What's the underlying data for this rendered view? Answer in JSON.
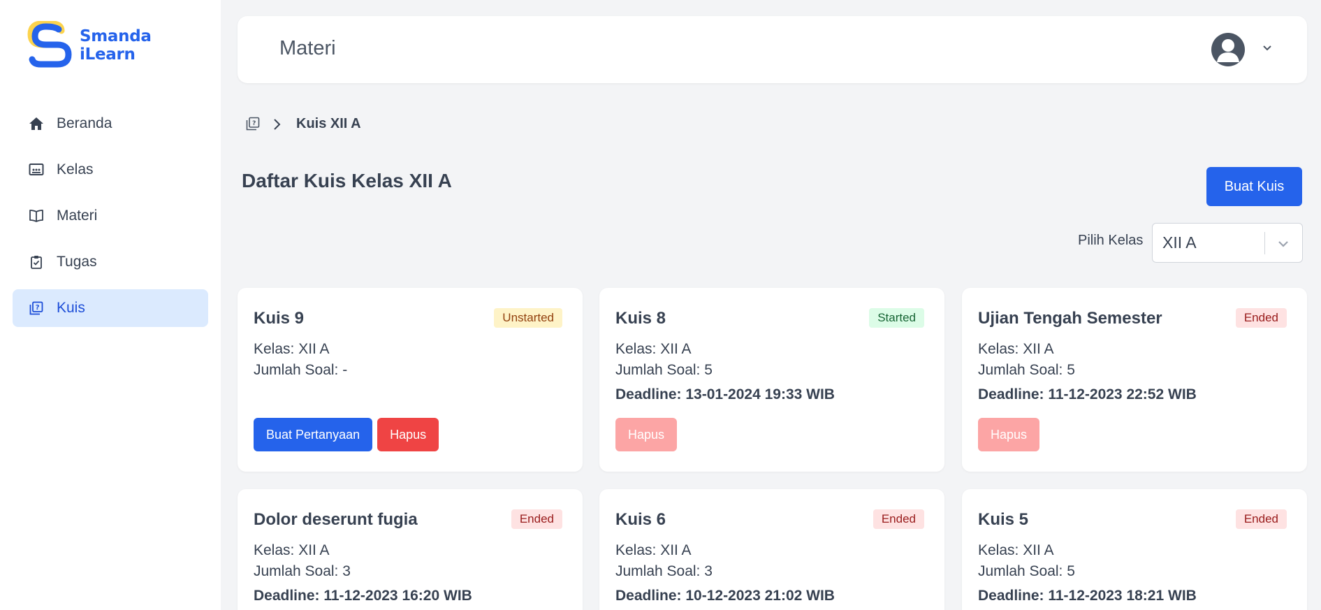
{
  "app": {
    "logo_line1": "Smanda",
    "logo_line2": "iLearn"
  },
  "sidebar": {
    "items": [
      {
        "label": "Beranda",
        "icon": "home-icon",
        "active": false
      },
      {
        "label": "Kelas",
        "icon": "class-board-icon",
        "active": false
      },
      {
        "label": "Materi",
        "icon": "book-icon",
        "active": false
      },
      {
        "label": "Tugas",
        "icon": "clipboard-check-icon",
        "active": false
      },
      {
        "label": "Kuis",
        "icon": "quiz-icon",
        "active": true
      }
    ]
  },
  "header": {
    "title": "Materi"
  },
  "breadcrumb": {
    "current": "Kuis XII A"
  },
  "page": {
    "title": "Daftar Kuis Kelas XII A",
    "create_button": "Buat Kuis",
    "select_label": "Pilih Kelas",
    "select_value": "XII A"
  },
  "cards": [
    {
      "title": "Kuis 9",
      "status": "Unstarted",
      "kelas": "Kelas: XII A",
      "jumlah": "Jumlah Soal: -",
      "deadline": "",
      "btn_primary": "Buat Pertanyaan",
      "btn_delete": "Hapus"
    },
    {
      "title": "Kuis 8",
      "status": "Started",
      "kelas": "Kelas: XII A",
      "jumlah": "Jumlah Soal: 5",
      "deadline": "Deadline: 13-01-2024 19:33 WIB",
      "btn_delete": "Hapus"
    },
    {
      "title": "Ujian Tengah Semester",
      "status": "Ended",
      "kelas": "Kelas: XII A",
      "jumlah": "Jumlah Soal: 5",
      "deadline": "Deadline: 11-12-2023 22:52 WIB",
      "btn_delete": "Hapus"
    },
    {
      "title": "Dolor deserunt fugia",
      "status": "Ended",
      "kelas": "Kelas: XII A",
      "jumlah": "Jumlah Soal: 3",
      "deadline": "Deadline: 11-12-2023 16:20 WIB"
    },
    {
      "title": "Kuis 6",
      "status": "Ended",
      "kelas": "Kelas: XII A",
      "jumlah": "Jumlah Soal: 3",
      "deadline": "Deadline: 10-12-2023 21:02 WIB"
    },
    {
      "title": "Kuis 5",
      "status": "Ended",
      "kelas": "Kelas: XII A",
      "jumlah": "Jumlah Soal: 5",
      "deadline": "Deadline: 11-12-2023 18:21 WIB"
    }
  ],
  "colors": {
    "primary": "#2563eb",
    "danger": "#ef4444",
    "danger_disabled": "#fca5a5",
    "active_nav_bg": "#dbeafe"
  }
}
